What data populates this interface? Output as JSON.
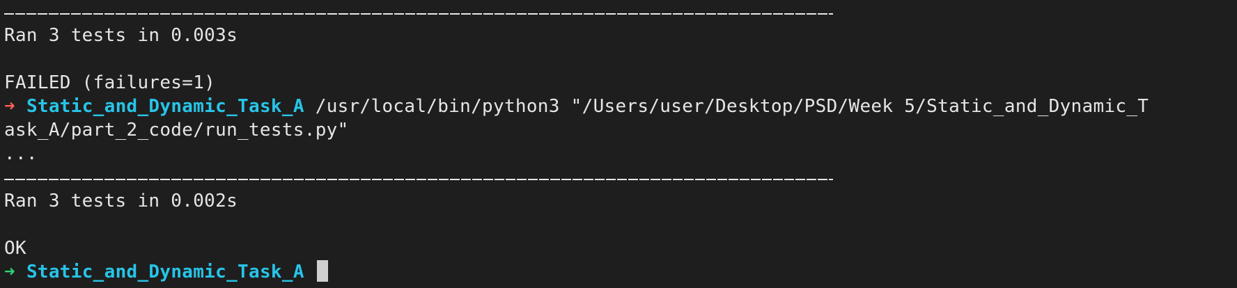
{
  "terminal": {
    "rule": "----------------------------------------------------------------------",
    "ran1": "Ran 3 tests in 0.003s",
    "failed": "FAILED (failures=1)",
    "prompt1": {
      "arrow": "➜",
      "dir": "Static_and_Dynamic_Task_A",
      "command_part1": " /usr/local/bin/python3 \"/Users/user/Desktop/PSD/Week 5/Static_and_Dynamic_T",
      "command_part2": "ask_A/part_2_code/run_tests.py\""
    },
    "dots": "...",
    "ran2": "Ran 3 tests in 0.002s",
    "ok": "OK",
    "prompt2": {
      "arrow": "➜",
      "dir": "Static_and_Dynamic_Task_A"
    },
    "colors": {
      "background": "#1e1e1e",
      "text": "#e6e6e6",
      "dir": "#27c5e8",
      "arrow_fail": "#ff5f57",
      "arrow_ok": "#2ed573"
    }
  }
}
